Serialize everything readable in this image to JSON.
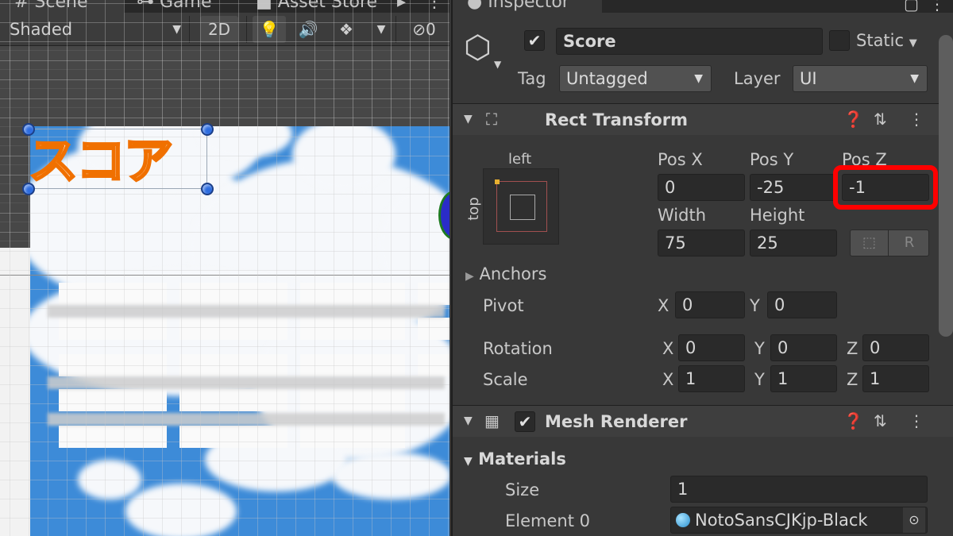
{
  "scene_tabs": {
    "scene": "# Scene",
    "game": "Game",
    "asset_store": "Asset Store"
  },
  "scene_toolbar": {
    "shading": "Shaded",
    "mode_2d": "2D",
    "hidden_count": "0"
  },
  "scene_content": {
    "score_label": "スコア"
  },
  "inspector": {
    "tab": "Inspector",
    "object": {
      "active": true,
      "name": "Score",
      "static_label": "Static",
      "tag_label": "Tag",
      "tag_value": "Untagged",
      "layer_label": "Layer",
      "layer_value": "UI"
    },
    "rect_transform": {
      "title": "Rect Transform",
      "anchor_h": "left",
      "anchor_v": "top",
      "pos_x_label": "Pos X",
      "pos_y_label": "Pos Y",
      "pos_z_label": "Pos Z",
      "pos_x": "0",
      "pos_y": "-25",
      "pos_z": "-1",
      "width_label": "Width",
      "height_label": "Height",
      "width": "75",
      "height": "25",
      "r_button": "R",
      "anchors_label": "Anchors",
      "pivot_label": "Pivot",
      "pivot_x": "0",
      "pivot_y": "0",
      "rotation_label": "Rotation",
      "rot_x": "0",
      "rot_y": "0",
      "rot_z": "0",
      "scale_label": "Scale",
      "scale_x": "1",
      "scale_y": "1",
      "scale_z": "1",
      "x": "X",
      "y": "Y",
      "z": "Z"
    },
    "mesh_renderer": {
      "title": "Mesh Renderer",
      "enabled": true,
      "materials_label": "Materials",
      "size_label": "Size",
      "size_value": "1",
      "element0_label": "Element 0",
      "element0_value": "NotoSansCJKjp-Black"
    }
  },
  "colors": {
    "highlight": "#ff0000",
    "panel_bg": "#383838",
    "field_bg": "#2a2a2a",
    "sky": "#3d8bd8",
    "score_outline": "#f07000"
  }
}
